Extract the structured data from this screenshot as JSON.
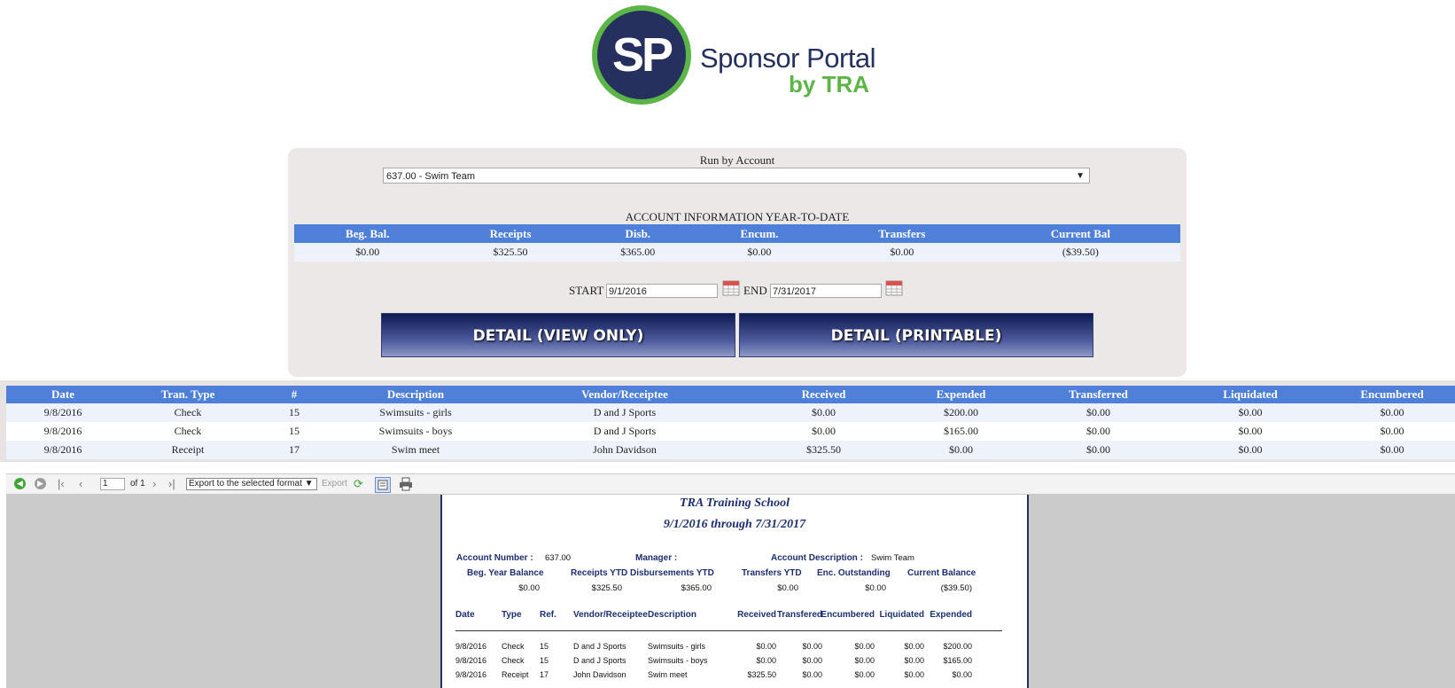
{
  "logo": {
    "initials": "SP",
    "title": "Sponsor Portal",
    "subtitle": "by TRA"
  },
  "panel": {
    "run_label": "Run by Account",
    "account_selected": "637.00 - Swim Team",
    "account_info_title": "ACCOUNT INFORMATION YEAR-TO-DATE",
    "summary_headers": [
      "Beg. Bal.",
      "Receipts",
      "Disb.",
      "Encum.",
      "Transfers",
      "Current Bal"
    ],
    "summary_values": [
      "$0.00",
      "$325.50",
      "$365.00",
      "$0.00",
      "$0.00",
      "($39.50)"
    ],
    "start_label": "START",
    "start_value": "9/1/2016",
    "end_label": "END",
    "end_value": "7/31/2017",
    "btn_view": "DETAIL (VIEW ONLY)",
    "btn_print": "DETAIL (PRINTABLE)"
  },
  "transactions": {
    "headers": [
      "Date",
      "Tran. Type",
      "#",
      "Description",
      "Vendor/Receiptee",
      "Received",
      "Expended",
      "Transferred",
      "Liquidated",
      "Encumbered"
    ],
    "rows": [
      [
        "9/8/2016",
        "Check",
        "15",
        "Swimsuits - girls",
        "D and J Sports",
        "$0.00",
        "$200.00",
        "$0.00",
        "$0.00",
        "$0.00"
      ],
      [
        "9/8/2016",
        "Check",
        "15",
        "Swimsuits - boys",
        "D and J Sports",
        "$0.00",
        "$165.00",
        "$0.00",
        "$0.00",
        "$0.00"
      ],
      [
        "9/8/2016",
        "Receipt",
        "17",
        "Swim meet",
        "John Davidson",
        "$325.50",
        "$0.00",
        "$0.00",
        "$0.00",
        "$0.00"
      ]
    ]
  },
  "viewer": {
    "page_value": "1",
    "page_of": "of 1",
    "export_select": "Export to the selected format",
    "export_label": "Export",
    "report": {
      "school": "TRA Training School",
      "range": "9/1/2016 through 7/31/2017",
      "account_number_label": "Account Number :",
      "account_number": "637.00",
      "manager_label": "Manager :",
      "account_desc_label": "Account Description :",
      "account_desc": "Swim Team",
      "balance_headers": [
        "Beg. Year Balance",
        "Receipts YTD",
        "Disbursements YTD",
        "Transfers YTD",
        "Enc. Outstanding",
        "Current Balance"
      ],
      "balance_values": [
        "$0.00",
        "$325.50",
        "$365.00",
        "$0.00",
        "$0.00",
        "($39.50)"
      ],
      "detail_headers": [
        "Date",
        "Type",
        "Ref.",
        "Vendor/Receiptee",
        "Description",
        "Received",
        "Transfered",
        "Encumbered",
        "Liquidated",
        "Expended"
      ],
      "detail_rows": [
        [
          "9/8/2016",
          "Check",
          "15",
          "D and J Sports",
          "Swimsuits - girls",
          "$0.00",
          "$0.00",
          "$0.00",
          "$0.00",
          "$200.00"
        ],
        [
          "9/8/2016",
          "Check",
          "15",
          "D and J Sports",
          "Swimsuits - boys",
          "$0.00",
          "$0.00",
          "$0.00",
          "$0.00",
          "$165.00"
        ],
        [
          "9/8/2016",
          "Receipt",
          "17",
          "John Davidson",
          "Swim meet",
          "$325.50",
          "$0.00",
          "$0.00",
          "$0.00",
          "$0.00"
        ]
      ]
    }
  }
}
